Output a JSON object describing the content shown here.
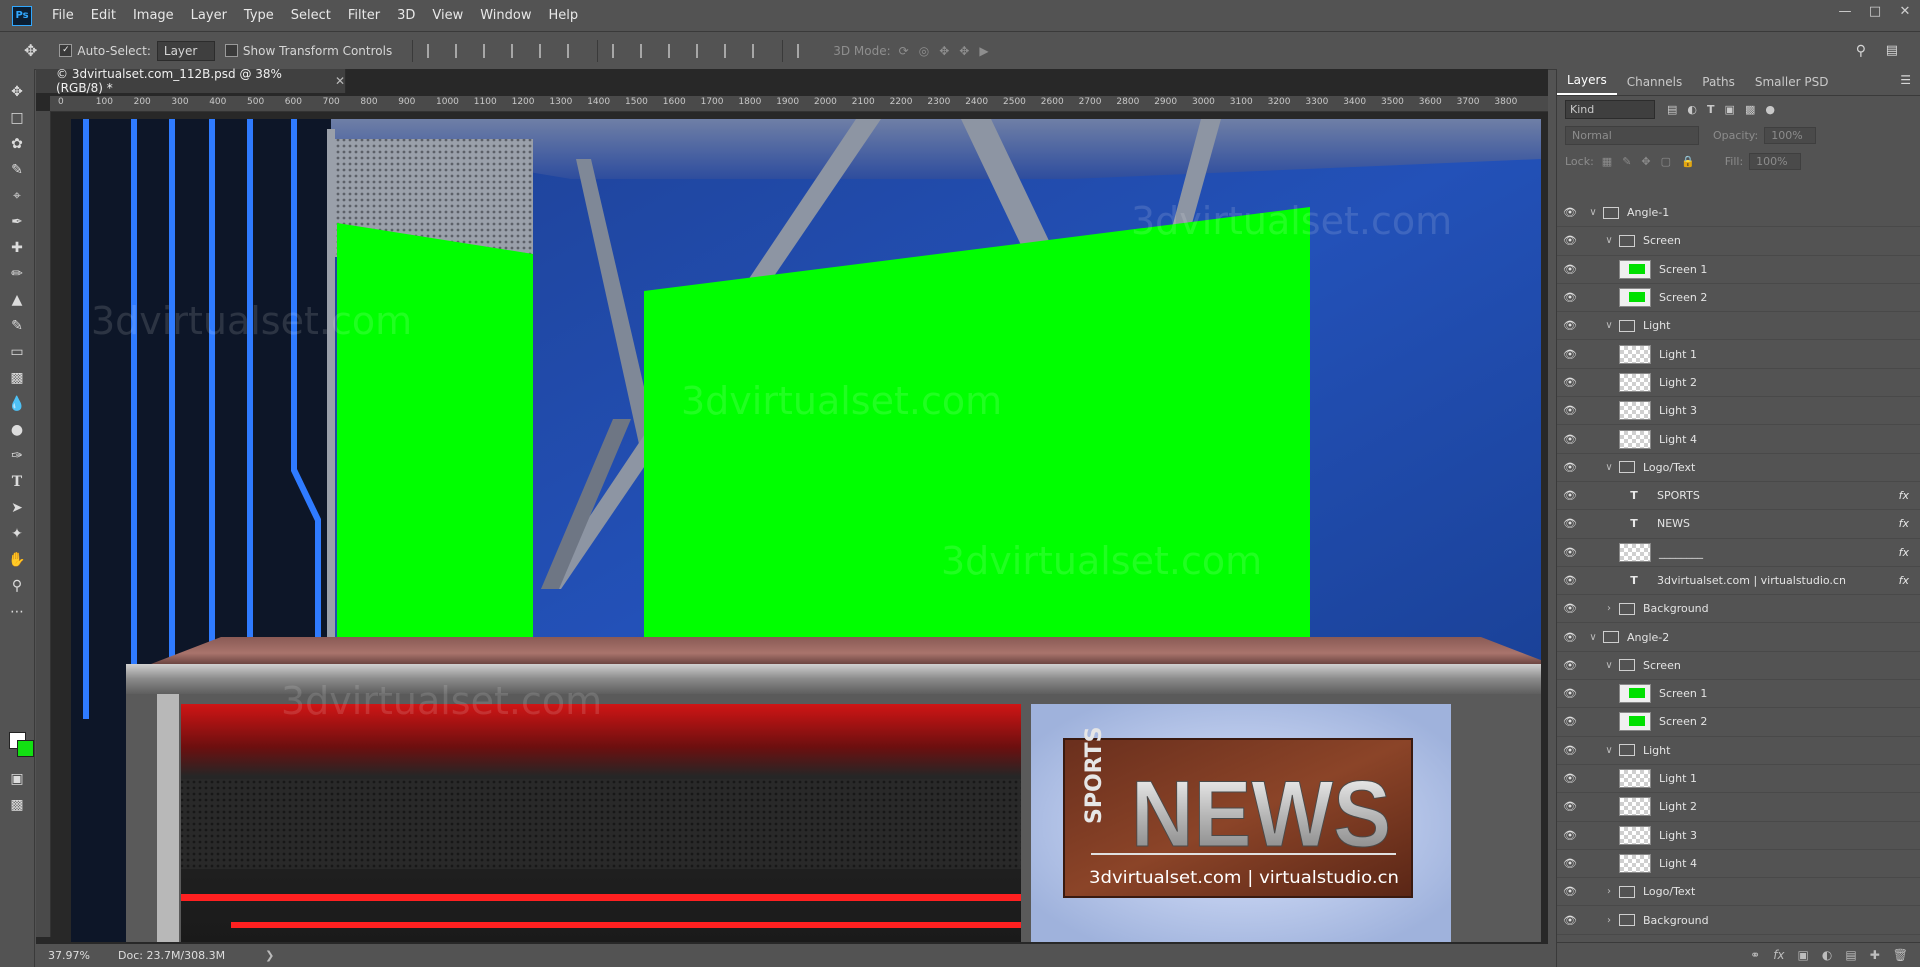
{
  "menubar": {
    "logo": "Ps",
    "items": [
      "File",
      "Edit",
      "Image",
      "Layer",
      "Type",
      "Select",
      "Filter",
      "3D",
      "View",
      "Window",
      "Help"
    ]
  },
  "options": {
    "auto_select_label": "Auto-Select:",
    "auto_select_value": "Layer",
    "show_transform_label": "Show Transform Controls",
    "mode_label": "3D Mode:"
  },
  "document": {
    "tab_title": "© 3dvirtualset.com_112B.psd @ 38% (RGB/8) *",
    "ruler_ticks": [
      "0",
      "100",
      "200",
      "300",
      "400",
      "500",
      "600",
      "700",
      "800",
      "900",
      "1000",
      "1100",
      "1200",
      "1300",
      "1400",
      "1500",
      "1600",
      "1700",
      "1800",
      "1900",
      "2000",
      "2100",
      "2200",
      "2300",
      "2400",
      "2500",
      "2600",
      "2700",
      "2800",
      "2900",
      "3000",
      "3100",
      "3200",
      "3300",
      "3400",
      "3500",
      "3600",
      "3700",
      "3800"
    ],
    "zoom": "37.97%",
    "doc_size": "Doc: 23.7M/308.3M"
  },
  "canvas": {
    "desk_sports": "SPORTS",
    "desk_news": "NEWS",
    "desk_sub": "3dvirtualset.com | virtualstudio.cn",
    "watermark": "3dvirtualset.com"
  },
  "panel": {
    "tabs": [
      "Layers",
      "Channels",
      "Paths",
      "Smaller PSD"
    ],
    "kind": "Kind",
    "blend": "Normal",
    "opacity_label": "Opacity:",
    "opacity_value": "100%",
    "lock_label": "Lock:",
    "fill_label": "Fill:",
    "fill_value": "100%"
  },
  "layers": [
    {
      "name": "Angle-1",
      "type": "group",
      "indent": 0,
      "open": true
    },
    {
      "name": "Screen",
      "type": "group",
      "indent": 1,
      "open": true
    },
    {
      "name": "Screen 1",
      "type": "screen",
      "indent": 2
    },
    {
      "name": "Screen 2",
      "type": "screen",
      "indent": 2
    },
    {
      "name": "Light",
      "type": "group",
      "indent": 1,
      "open": true
    },
    {
      "name": "Light 1",
      "type": "pixel",
      "indent": 2
    },
    {
      "name": "Light 2",
      "type": "pixel",
      "indent": 2
    },
    {
      "name": "Light 3",
      "type": "pixel",
      "indent": 2
    },
    {
      "name": "Light 4",
      "type": "pixel",
      "indent": 2
    },
    {
      "name": "Logo/Text",
      "type": "group",
      "indent": 1,
      "open": true
    },
    {
      "name": "SPORTS",
      "type": "text",
      "indent": 2,
      "fx": true
    },
    {
      "name": "NEWS",
      "type": "text",
      "indent": 2,
      "fx": true
    },
    {
      "name": "________",
      "type": "pixel",
      "indent": 2,
      "fx": true
    },
    {
      "name": "3dvirtualset.com | virtualstudio.cn",
      "type": "text",
      "indent": 2,
      "fx": true
    },
    {
      "name": "Background",
      "type": "group",
      "indent": 1,
      "open": false
    },
    {
      "name": "Angle-2",
      "type": "group",
      "indent": 0,
      "open": true
    },
    {
      "name": "Screen",
      "type": "group",
      "indent": 1,
      "open": true
    },
    {
      "name": "Screen 1",
      "type": "screen",
      "indent": 2
    },
    {
      "name": "Screen 2",
      "type": "screen",
      "indent": 2
    },
    {
      "name": "Light",
      "type": "group",
      "indent": 1,
      "open": true
    },
    {
      "name": "Light 1",
      "type": "pixel",
      "indent": 2
    },
    {
      "name": "Light 2",
      "type": "pixel",
      "indent": 2
    },
    {
      "name": "Light 3",
      "type": "pixel",
      "indent": 2
    },
    {
      "name": "Light 4",
      "type": "pixel",
      "indent": 2
    },
    {
      "name": "Logo/Text",
      "type": "group",
      "indent": 1,
      "open": false
    },
    {
      "name": "Background",
      "type": "group",
      "indent": 1,
      "open": false
    }
  ],
  "fx_label": "fx"
}
